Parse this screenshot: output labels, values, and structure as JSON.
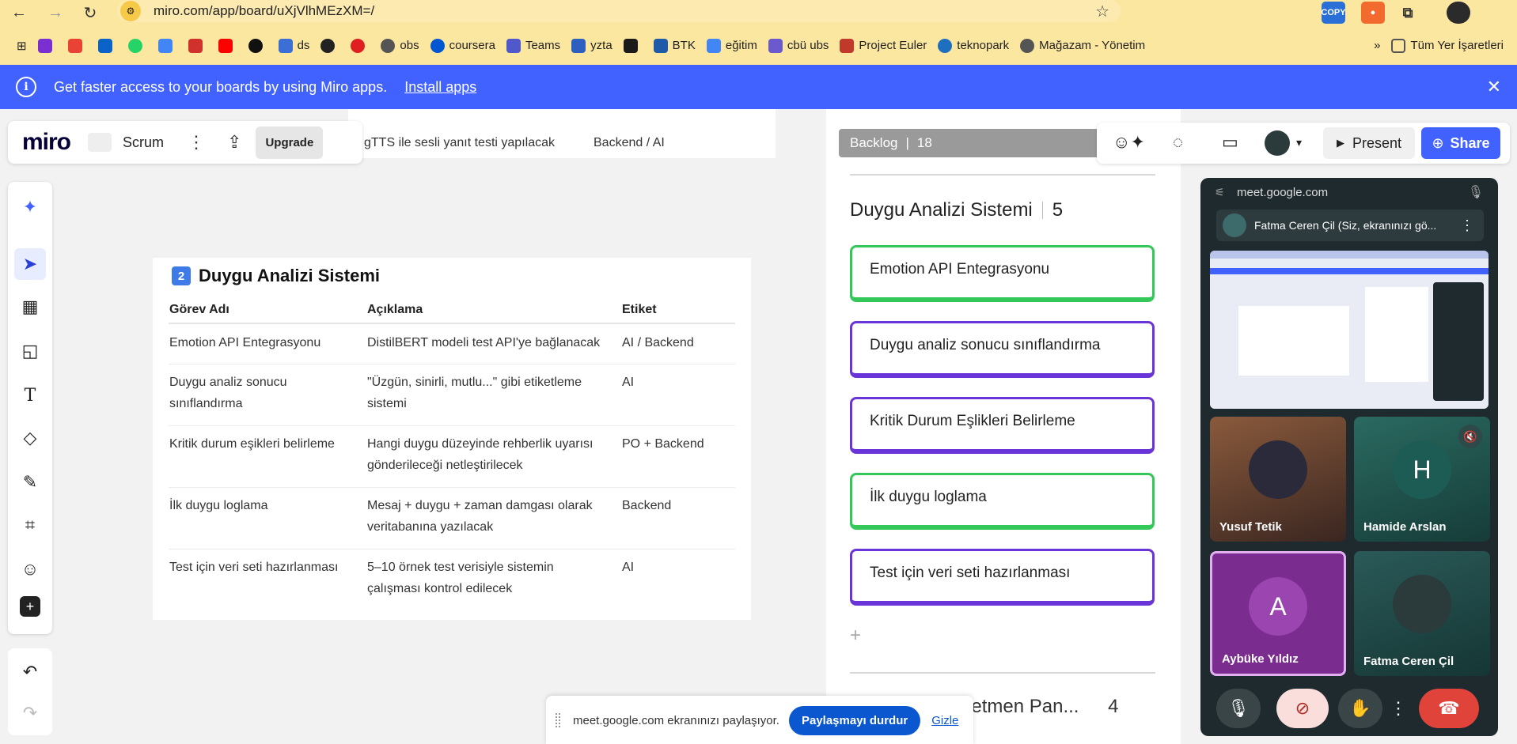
{
  "browser": {
    "url": "miro.com/app/board/uXjVlhMEzXM=/",
    "bookmarks": [
      "",
      "",
      "",
      "",
      "",
      "",
      "",
      "",
      "ds",
      "",
      "",
      "obs",
      "coursera",
      "Teams",
      "yzta",
      "",
      "BTK",
      "eğitim",
      "cbü ubs",
      "Project Euler",
      "teknopark",
      "Mağazam - Yönetim"
    ],
    "all_bookmarks": "Tüm Yer İşaretleri",
    "more": "»",
    "copy_ext": "COPY"
  },
  "banner": {
    "text": "Get faster access to your boards by using Miro apps.",
    "link": "Install apps",
    "close": "✕"
  },
  "toolbar": {
    "logo": "miro",
    "board_name": "Scrum",
    "upgrade": "Upgrade"
  },
  "top_card": {
    "desc": "gTTS ile sesli yanıt testi yapılacak",
    "tag": "Backend / AI"
  },
  "table": {
    "number": "2",
    "title": "Duygu Analizi Sistemi",
    "headers": [
      "Görev Adı",
      "Açıklama",
      "Etiket"
    ],
    "rows": [
      {
        "name": "Emotion API Entegrasyonu",
        "name2": "",
        "desc": "DistilBERT modeli test API'ye bağlanacak",
        "desc2": "",
        "tag": "AI / Backend"
      },
      {
        "name": "Duygu analiz sonucu",
        "name2": "sınıflandırma",
        "desc": "\"Üzgün, sinirli, mutlu...\" gibi etiketleme",
        "desc2": "sistemi",
        "tag": "AI"
      },
      {
        "name": "Kritik durum eşikleri belirleme",
        "name2": "",
        "desc": "Hangi duygu düzeyinde rehberlik uyarısı",
        "desc2": "gönderileceği netleştirilecek",
        "tag": "PO + Backend"
      },
      {
        "name": "İlk duygu loglama",
        "name2": "",
        "desc": "Mesaj + duygu + zaman damgası olarak",
        "desc2": "veritabanına yazılacak",
        "tag": "Backend"
      },
      {
        "name": "Test için veri seti hazırlanması",
        "name2": "",
        "desc": "5–10 örnek test verisiyle sistemin",
        "desc2": "çalışması kontrol edilecek",
        "tag": "AI"
      }
    ]
  },
  "backlog": {
    "header": "Backlog",
    "count": "18",
    "section_title": "Duygu Analizi Sistemi",
    "section_count": "5",
    "tasks": [
      {
        "label": "Emotion API Entegrasyonu",
        "color": "green"
      },
      {
        "label": "Duygu analiz sonucu sınıflandırma",
        "color": "purple"
      },
      {
        "label": "Kritik Durum Eşlikleri Belirleme",
        "color": "purple"
      },
      {
        "label": "İlk duygu loglama",
        "color": "green"
      },
      {
        "label": "Test için veri seti hazırlanması",
        "color": "purple"
      }
    ],
    "add": "+",
    "next_section": "Öğrenci & Öğretmen Pan...",
    "next_count": "4"
  },
  "right_toolbar": {
    "present": "Present",
    "share": "Share"
  },
  "meet": {
    "url": "meet.google.com",
    "presenter": "Fatma Ceren Çil (Siz, ekranınızı gö...",
    "participants": [
      {
        "name": "Yusuf Tetik",
        "initial": "",
        "color": "#6b4a3a"
      },
      {
        "name": "Hamide Arslan",
        "initial": "H",
        "color": "#1d5c54"
      },
      {
        "name": "Aybüke Yıldız",
        "initial": "A",
        "color": "#7b2c8f"
      },
      {
        "name": "Fatma Ceren Çil",
        "initial": "",
        "color": "#1f4a48"
      }
    ]
  },
  "sharebar": {
    "text": "meet.google.com ekranınızı paylaşıyor.",
    "stop": "Paylaşmayı durdur",
    "hide": "Gizle"
  },
  "colors": {
    "miro_blue": "#4262ff",
    "task_green": "#34c759",
    "task_purple": "#6a35d8",
    "meet_red": "#e0433a"
  }
}
